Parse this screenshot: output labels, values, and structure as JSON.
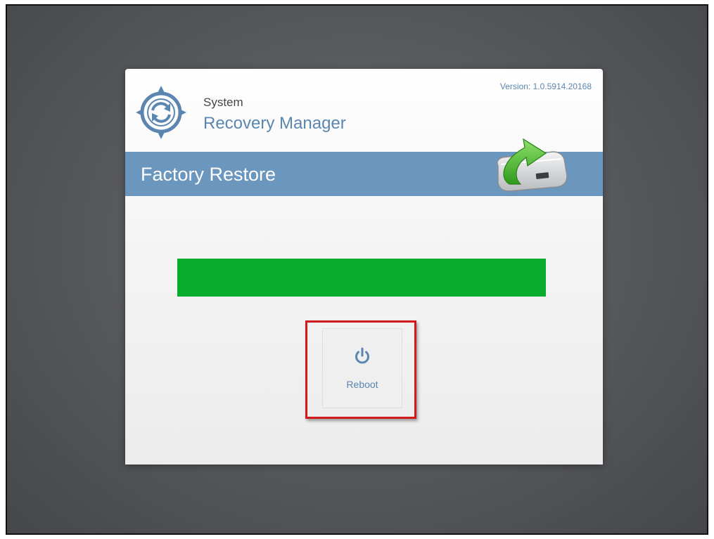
{
  "app": {
    "title_line1": "System",
    "title_line2": "Recovery Manager",
    "version": "Version: 1.0.5914.20168",
    "logo_icon": "sync-compass-icon"
  },
  "banner": {
    "title": "Factory Restore",
    "icon": "drive-restore-icon",
    "color": "#6b96bd"
  },
  "progress": {
    "fraction": 1.0,
    "color": "#07ab2d"
  },
  "reboot": {
    "label": "Reboot",
    "icon": "power-icon",
    "highlight_color": "#d21a1a"
  },
  "colors": {
    "accent": "#5a86b0",
    "background": "#55575b"
  }
}
